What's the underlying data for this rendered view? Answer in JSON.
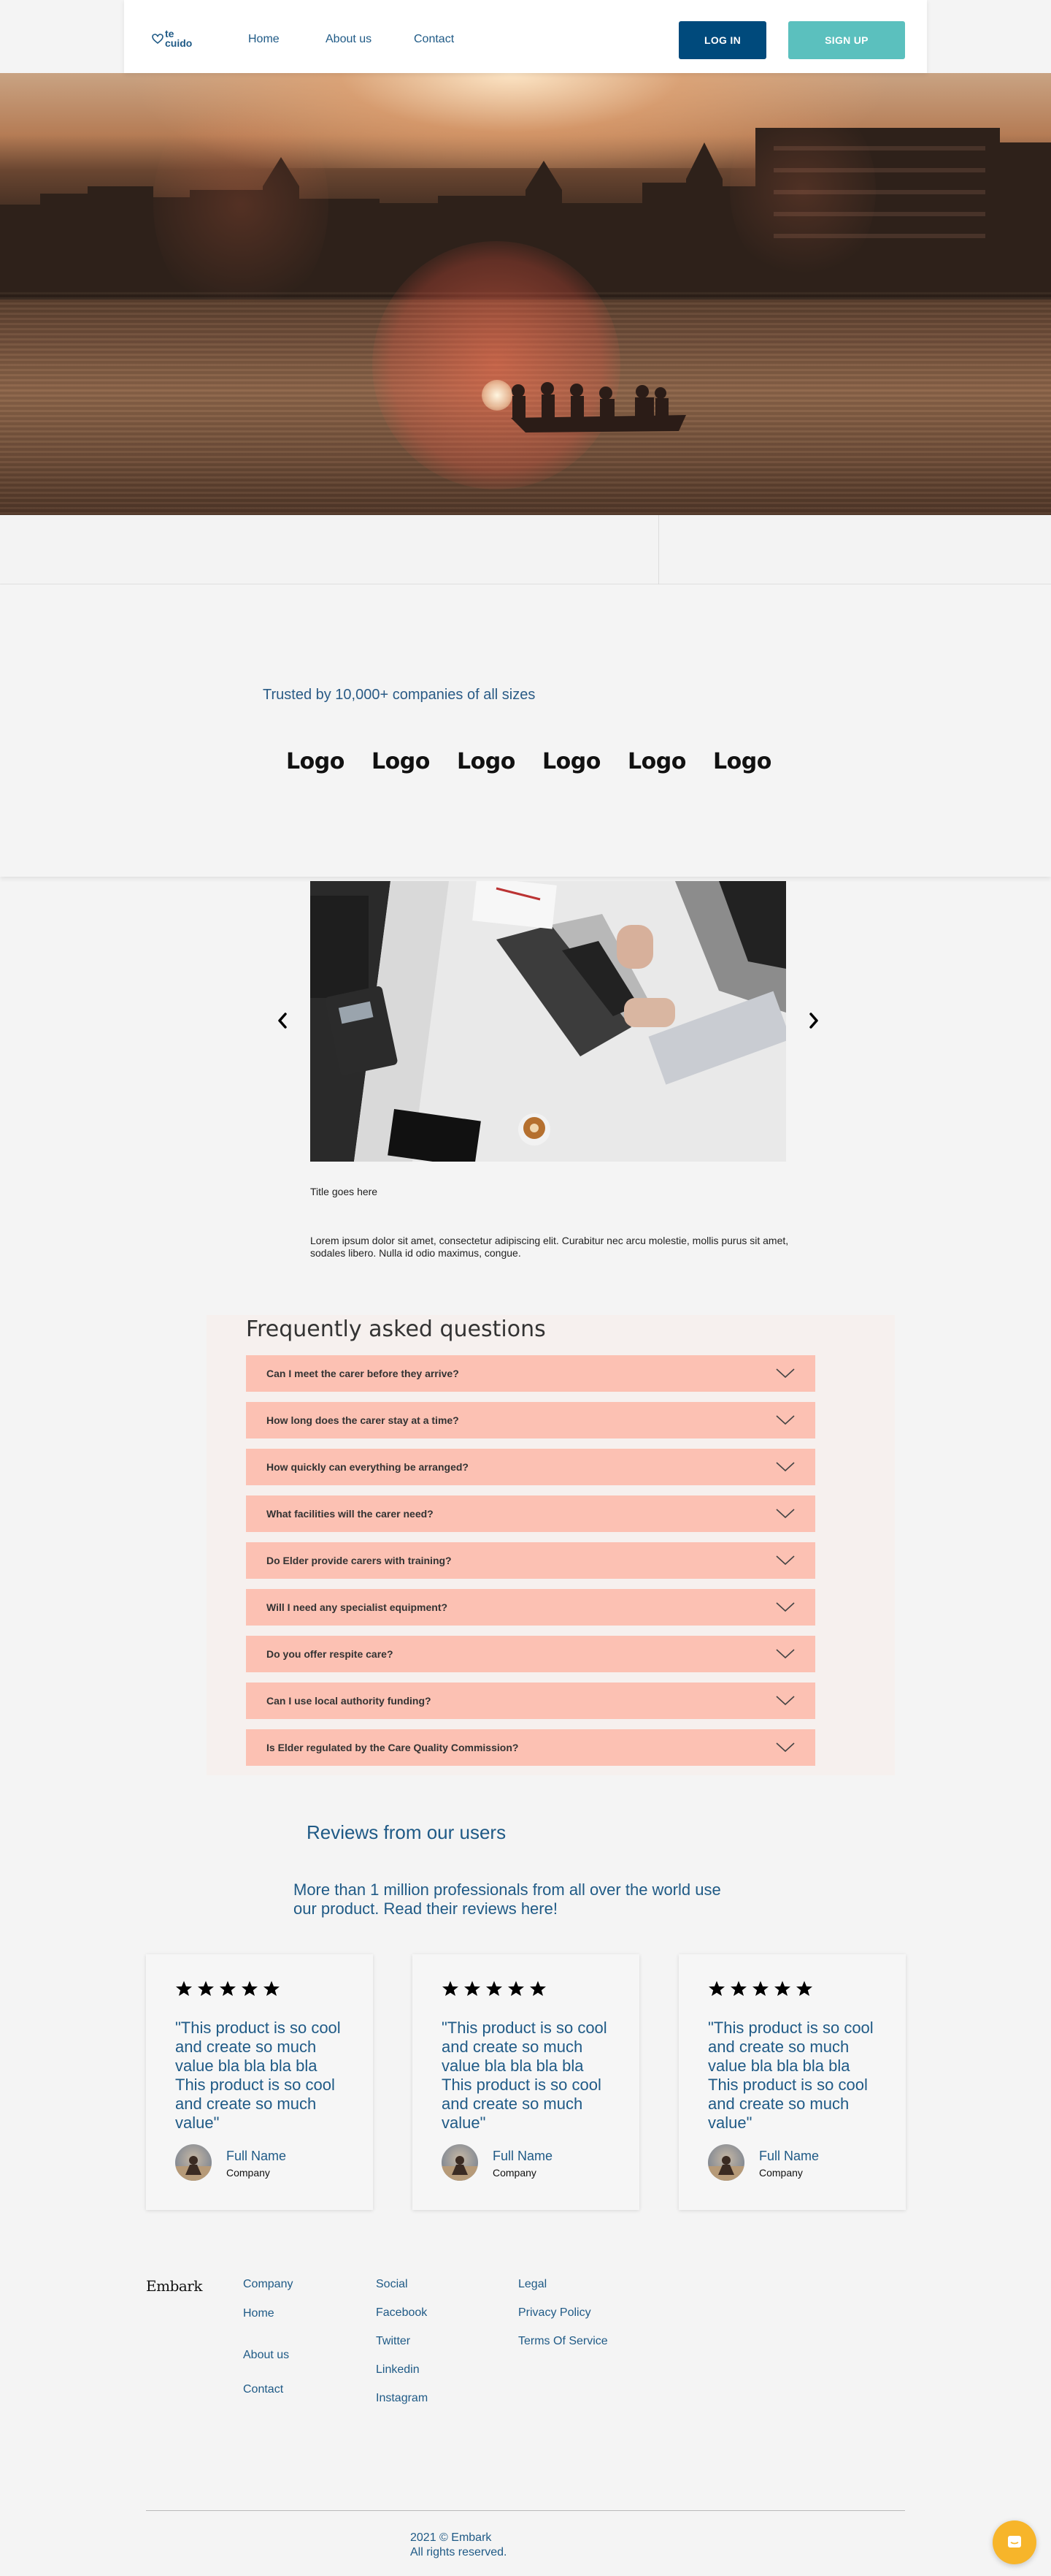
{
  "brand": {
    "logo_text": "te cuido"
  },
  "nav": {
    "links": [
      {
        "label": "Home"
      },
      {
        "label": "About us"
      },
      {
        "label": "Contact"
      }
    ],
    "login_label": "LOG IN",
    "signup_label": "SIGN UP"
  },
  "colors": {
    "primary": "#004a7c",
    "accent": "#5bc0be",
    "faq_item": "#fcc1b3",
    "text_blue": "#1f5a86",
    "chat": "#f7b52a"
  },
  "trusted": {
    "text": "Trusted by 10,000+ companies of all sizes",
    "logos": [
      "Logo",
      "Logo",
      "Logo",
      "Logo",
      "Logo",
      "Logo"
    ]
  },
  "carousel": {
    "prev_icon": "chevron-left-icon",
    "next_icon": "chevron-right-icon",
    "title": "Title goes here",
    "body": "Lorem ipsum dolor sit amet, consectetur adipiscing elit. Curabitur nec arcu molestie, mollis purus sit amet, sodales libero. Nulla id odio maximus, congue."
  },
  "faq": {
    "title": "Frequently asked questions",
    "items": [
      "Can I meet the carer before they arrive?",
      "How long does the carer stay at a time?",
      "How quickly can everything be arranged?",
      "What facilities will the carer need?",
      "Do Elder provide carers with training?",
      "Will I need any specialist equipment?",
      "Do you offer respite care?",
      "Can I use local authority funding?",
      "Is Elder regulated by the Care Quality Commission?"
    ]
  },
  "reviews": {
    "title": "Reviews from our users",
    "subtitle": "More than 1 million professionals from all over the world use our product. Read their reviews here!",
    "cards": [
      {
        "rating": 5,
        "quote": "\"This product is so cool and create so much value bla bla bla bla This product is so cool and create so much value\"",
        "name": "Full Name",
        "company": "Company"
      },
      {
        "rating": 5,
        "quote": "\"This product is so cool and create so much value bla bla bla bla This product is so cool and create so much value\"",
        "name": "Full Name",
        "company": "Company"
      },
      {
        "rating": 5,
        "quote": "\"This product is so cool and create so much value bla bla bla bla This product is so cool and create so much value\"",
        "name": "Full Name",
        "company": "Company"
      }
    ]
  },
  "footer": {
    "brand": "Embark",
    "col1": [
      "Company",
      "Home",
      "About us",
      "Contact"
    ],
    "col2": [
      "Social",
      "Facebook",
      "Twitter",
      "Linkedin",
      "Instagram"
    ],
    "col3": [
      "Legal",
      "Privacy Policy",
      "Terms Of Service"
    ],
    "copyright_line1": "2021 © Embark",
    "copyright_line2": "All rights reserved."
  }
}
